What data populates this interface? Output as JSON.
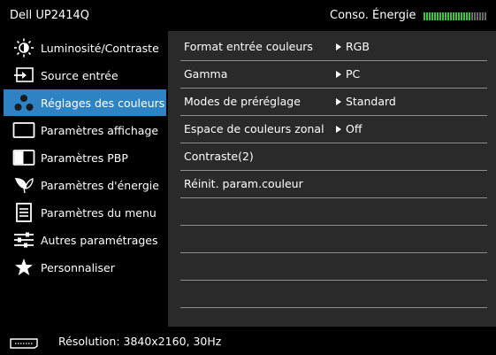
{
  "header": {
    "title": "Dell UP2414Q",
    "energy_label": "Conso. Énergie",
    "energy_level": 0.75,
    "colors": {
      "meter_on": "#3cc43c",
      "meter_off": "#6a6a6a"
    }
  },
  "sidebar": {
    "items": [
      {
        "label": "Luminosité/Contraste",
        "icon": "brightness-icon"
      },
      {
        "label": "Source entrée",
        "icon": "input-source-icon"
      },
      {
        "label": "Réglages des couleurs",
        "icon": "color-settings-icon",
        "selected": true
      },
      {
        "label": "Paramètres affichage",
        "icon": "display-settings-icon"
      },
      {
        "label": "Paramètres PBP",
        "icon": "pbp-icon"
      },
      {
        "label": "Paramètres d'énergie",
        "icon": "energy-icon"
      },
      {
        "label": "Paramètres du menu",
        "icon": "menu-settings-icon"
      },
      {
        "label": "Autres paramétrages",
        "icon": "other-settings-icon"
      },
      {
        "label": "Personnaliser",
        "icon": "star-icon"
      }
    ],
    "selected_color": "#2d83c4"
  },
  "content": {
    "rows": [
      {
        "label": "Format entrée couleurs",
        "value": "RGB"
      },
      {
        "label": "Gamma",
        "value": "PC"
      },
      {
        "label": "Modes de préréglage",
        "value": "Standard"
      },
      {
        "label": "Espace de couleurs zonal",
        "value": "Off"
      },
      {
        "label": "Contraste(2)",
        "value": ""
      },
      {
        "label": "Réinit. param.couleur",
        "value": ""
      },
      {
        "label": "",
        "value": ""
      },
      {
        "label": "",
        "value": ""
      },
      {
        "label": "",
        "value": ""
      },
      {
        "label": "",
        "value": ""
      }
    ]
  },
  "status": {
    "resolution": "Résolution: 3840x2160, 30Hz",
    "input_icon": "displayport-icon"
  }
}
